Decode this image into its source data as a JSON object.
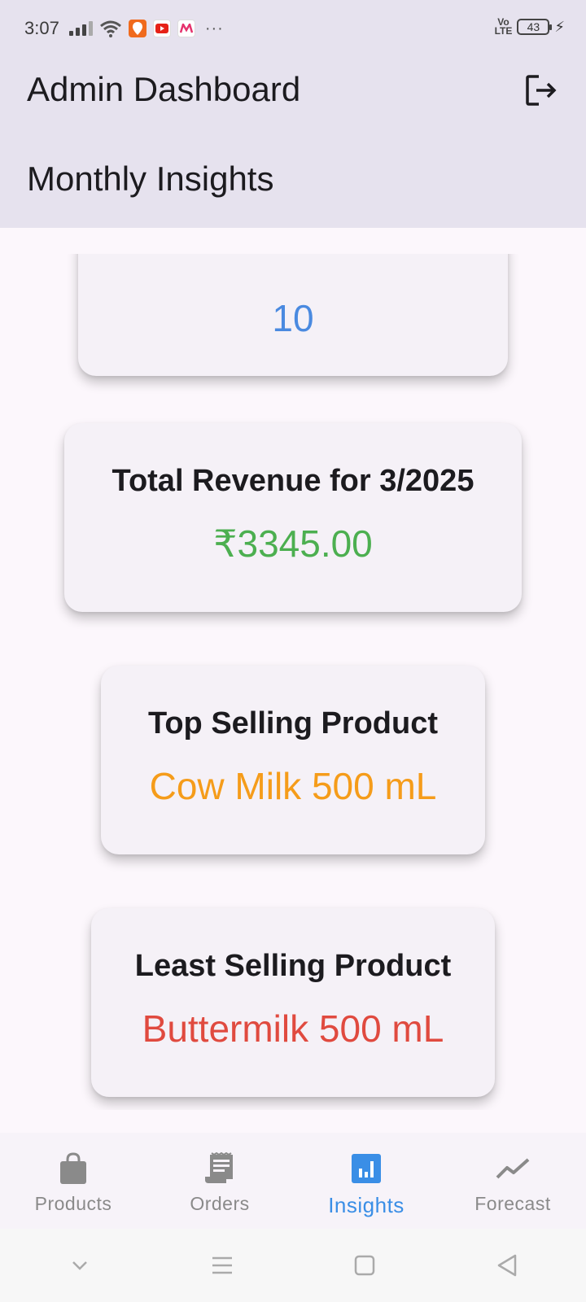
{
  "status_bar": {
    "time": "3:07",
    "dots": "···",
    "volte_top": "Vo",
    "volte_bottom": "LTE",
    "battery": "43"
  },
  "app_bar": {
    "title": "Admin Dashboard",
    "section_title": "Monthly Insights",
    "logout_icon": "logout-icon"
  },
  "cards": {
    "orders": {
      "value": "10",
      "color": "#4a8ae0"
    },
    "revenue": {
      "title": "Total Revenue for 3/2025",
      "value": "₹3345.00",
      "color": "#4caf50"
    },
    "top_product": {
      "title": "Top Selling Product",
      "value": "Cow Milk 500 mL",
      "color": "#f59c1a"
    },
    "least_product": {
      "title": "Least Selling Product",
      "value": "Buttermilk 500 mL",
      "color": "#e04a3f"
    }
  },
  "bottom_nav": {
    "items": [
      {
        "label": "Products",
        "icon": "shopping-bag-icon",
        "active": false
      },
      {
        "label": "Orders",
        "icon": "receipt-icon",
        "active": false
      },
      {
        "label": "Insights",
        "icon": "insights-icon",
        "active": true
      },
      {
        "label": "Forecast",
        "icon": "trending-icon",
        "active": false
      }
    ]
  },
  "system_nav": [
    "chevron-down-icon",
    "menu-icon",
    "home-square-icon",
    "back-triangle-icon"
  ],
  "colors": {
    "app_bar_bg": "#e6e2ee",
    "page_bg": "#fcf7fc",
    "accent": "#3a8ee6"
  }
}
